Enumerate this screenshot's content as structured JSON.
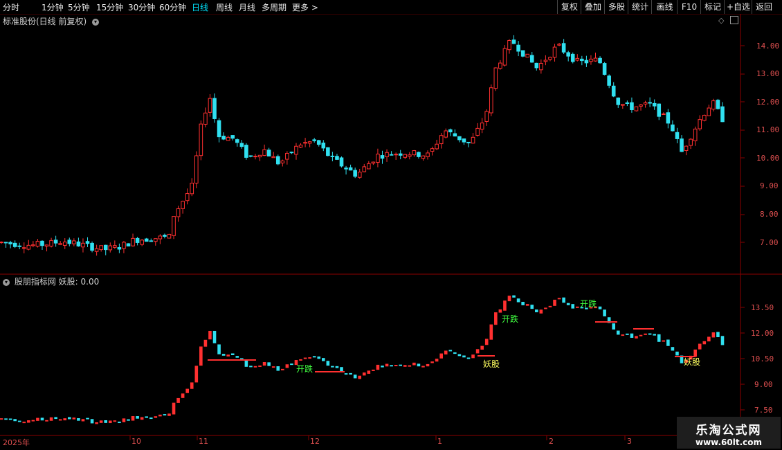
{
  "toolbar": {
    "periods": [
      "分时",
      "1分钟",
      "5分钟",
      "15分钟",
      "30分钟",
      "60分钟",
      "日线",
      "周线",
      "月线",
      "多周期",
      "更多 >"
    ],
    "active_period": "日线",
    "right_buttons": [
      "复权",
      "叠加",
      "多股",
      "统计",
      "画线",
      "F10",
      "标记",
      "+自选",
      "返回"
    ]
  },
  "main_panel": {
    "title": "标准股份(日线 前复权)",
    "price_labels": [
      "14.00",
      "13.00",
      "12.00",
      "11.00",
      "10.00",
      "9.00",
      "8.00",
      "7.00"
    ]
  },
  "indicator_panel": {
    "title": "股朋指标网  妖股: 0.00",
    "price_labels": [
      "13.50",
      "12.00",
      "10.50",
      "9.00",
      "7.50"
    ],
    "signals": {
      "kai_die": "开跌",
      "yao_gu": "妖股"
    }
  },
  "x_axis": {
    "dates": [
      "2025年",
      "10",
      "11",
      "12",
      "1",
      "2",
      "3"
    ]
  },
  "watermark": {
    "line1": "乐淘公式网",
    "line2": "www.60lt.com"
  },
  "colors": {
    "up": "#ff3030",
    "down": "#30e0f0",
    "axis": "#8b0000",
    "active": "#00e5ff"
  }
}
